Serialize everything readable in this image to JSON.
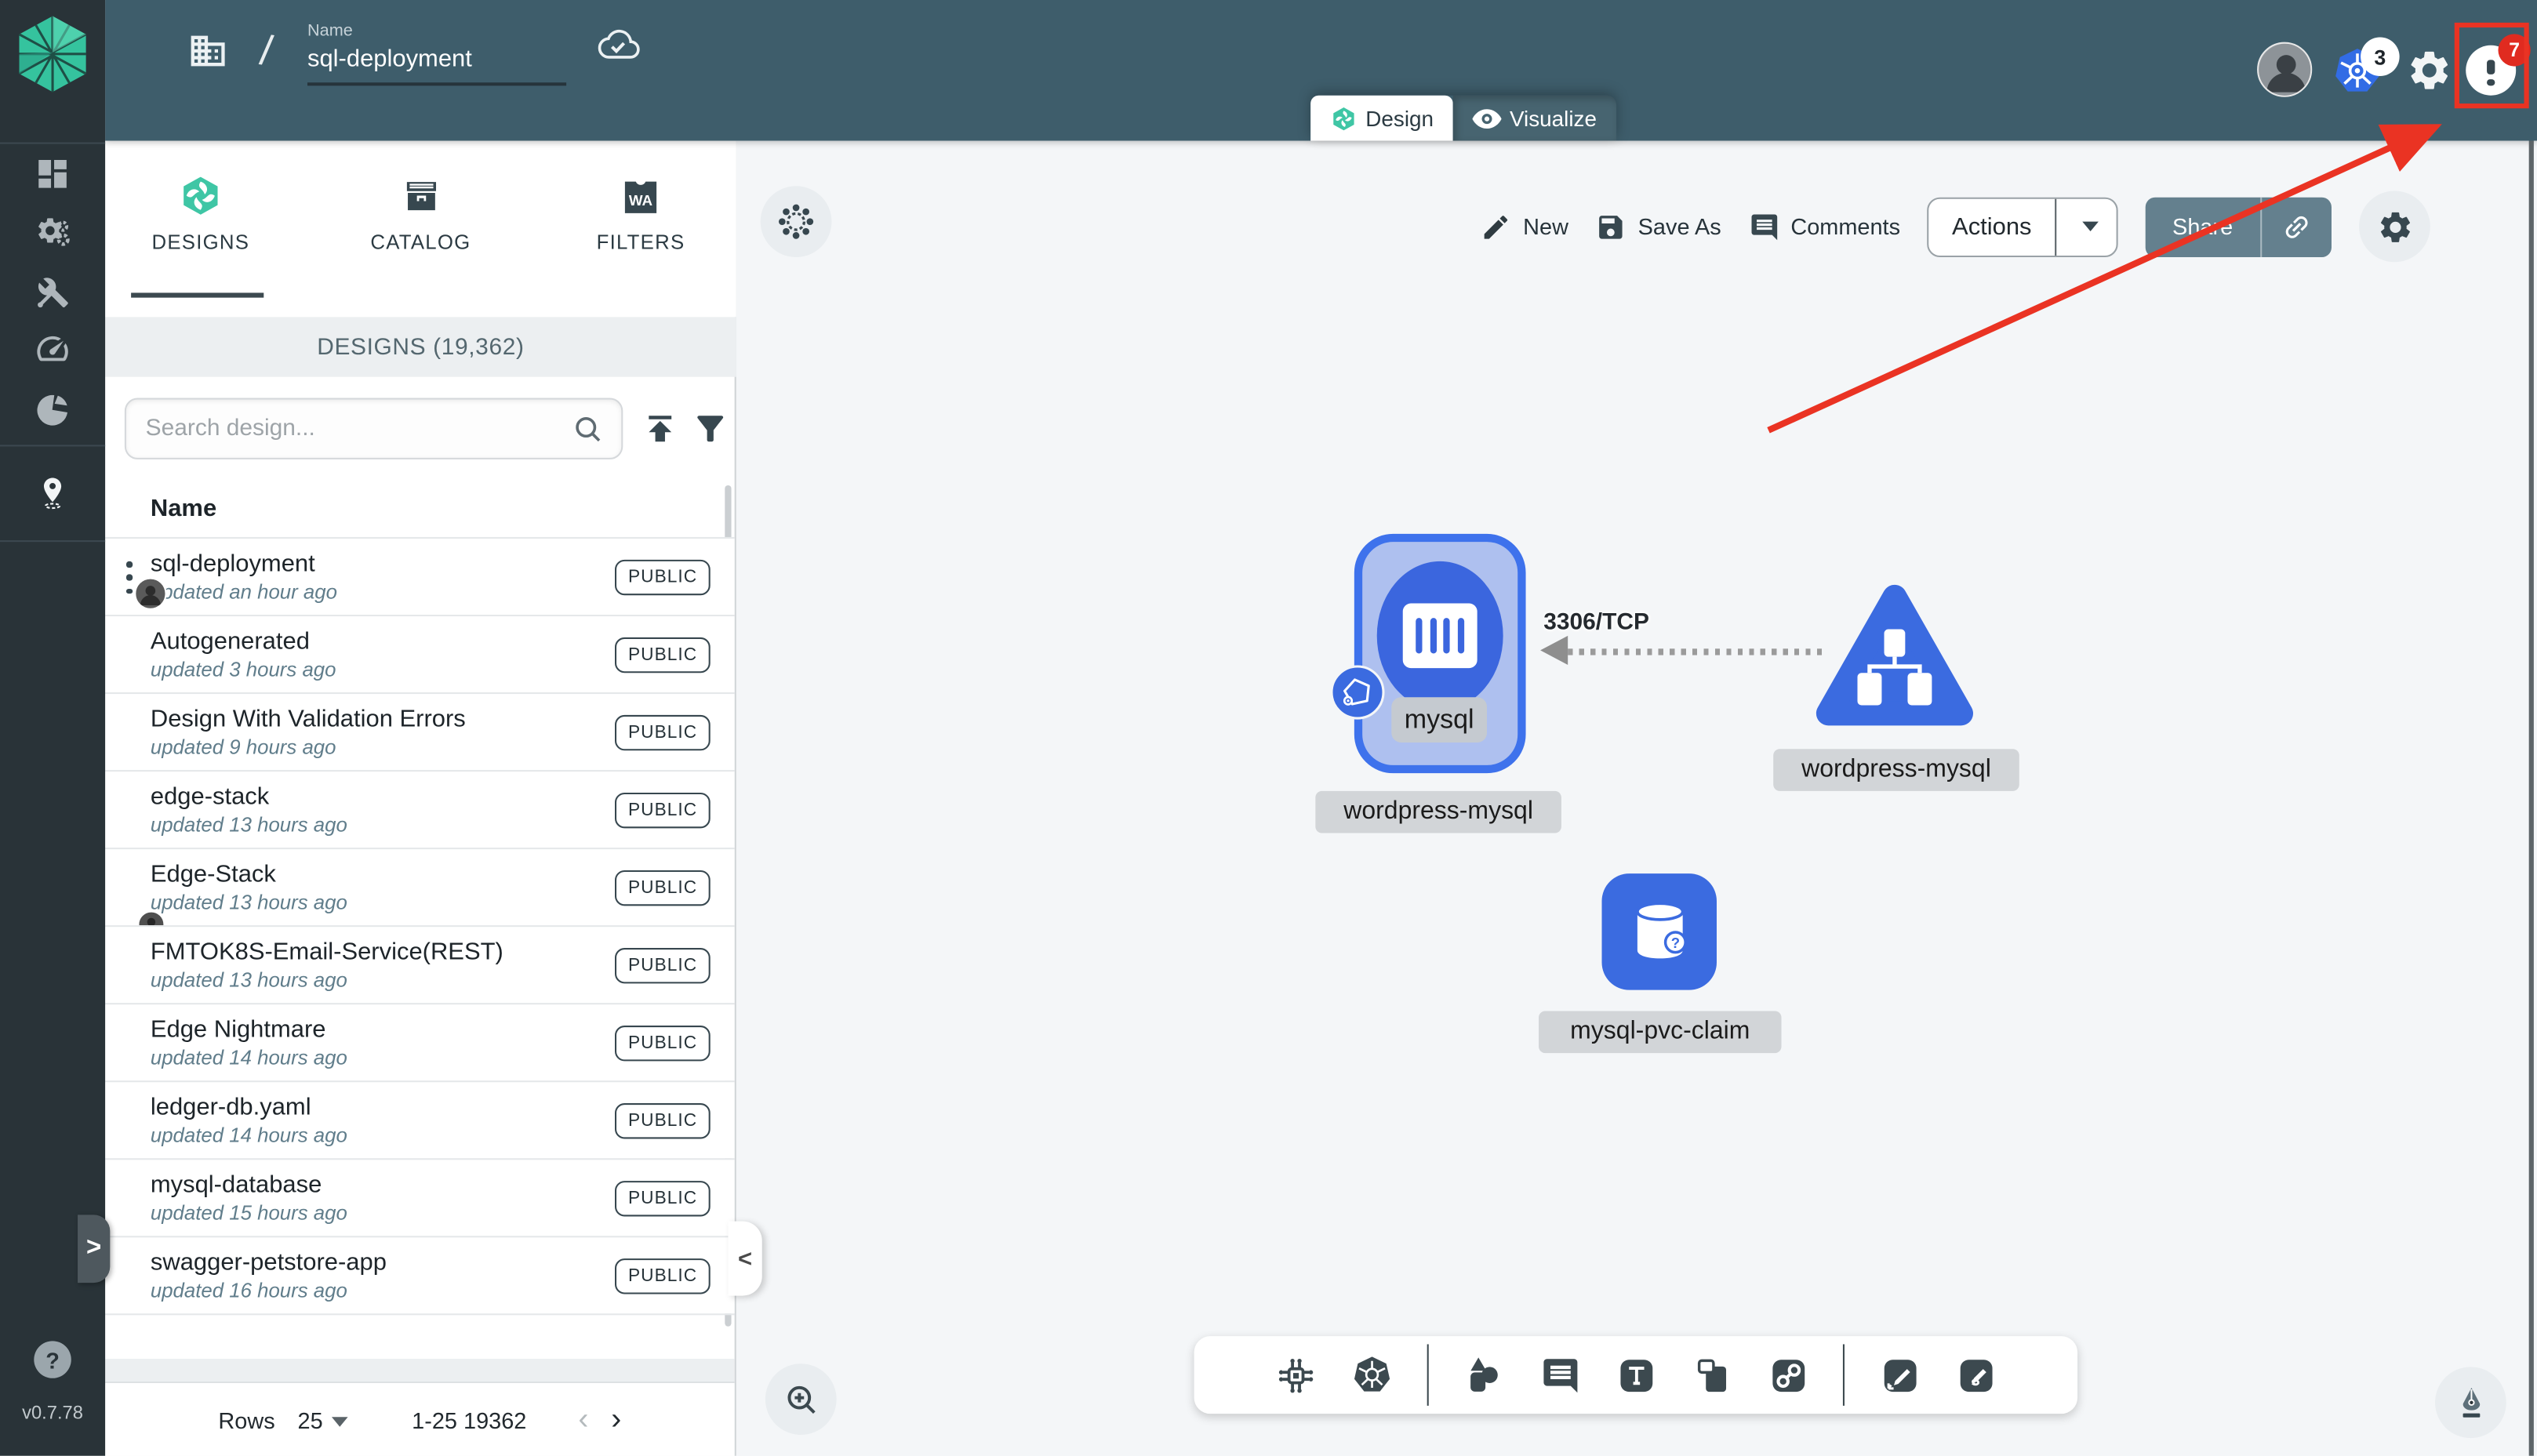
{
  "topbar": {
    "name_label": "Name",
    "name_value": "sql-deployment",
    "slash": "/",
    "mode_tabs": {
      "design": "Design",
      "visualize": "Visualize"
    },
    "k8s_context_count": "3",
    "notification_count": "7"
  },
  "sidebar": {
    "version": "v0.7.78",
    "help": "?",
    "expander": ">"
  },
  "panel": {
    "tabs": {
      "designs": "DESIGNS",
      "catalog": "CATALOG",
      "filters": "FILTERS"
    },
    "filters_icon_text": "WA",
    "section_title": "DESIGNS (19,362)",
    "search_placeholder": "Search design...",
    "name_header": "Name",
    "rows": [
      {
        "name": "sql-deployment",
        "updated": "updated an hour ago",
        "visibility": "PUBLIC"
      },
      {
        "name": "Autogenerated",
        "updated": "updated 3 hours ago",
        "visibility": "PUBLIC"
      },
      {
        "name": "Design With Validation Errors",
        "updated": "updated 9 hours ago",
        "visibility": "PUBLIC"
      },
      {
        "name": "edge-stack",
        "updated": "updated 13 hours ago",
        "visibility": "PUBLIC"
      },
      {
        "name": "Edge-Stack",
        "updated": "updated 13 hours ago",
        "visibility": "PUBLIC"
      },
      {
        "name": "FMTOK8S-Email-Service(REST)",
        "updated": "updated 13 hours ago",
        "visibility": "PUBLIC"
      },
      {
        "name": "Edge Nightmare",
        "updated": "updated 14 hours ago",
        "visibility": "PUBLIC"
      },
      {
        "name": "ledger-db.yaml",
        "updated": "updated 14 hours ago",
        "visibility": "PUBLIC"
      },
      {
        "name": "mysql-database",
        "updated": "updated 15 hours ago",
        "visibility": "PUBLIC"
      },
      {
        "name": "swagger-petstore-app",
        "updated": "updated 16 hours ago",
        "visibility": "PUBLIC"
      }
    ],
    "footer": {
      "rows_label": "Rows",
      "rows_per_page": "25",
      "range": "1-25 19362",
      "prev": "‹",
      "next": "›"
    },
    "collapse_chevron": "<"
  },
  "canvas": {
    "toolbar": {
      "new": "New",
      "save_as": "Save As",
      "comments": "Comments",
      "actions": "Actions",
      "share": "Share"
    },
    "diagram": {
      "deployment_node_label": "wordpress-mysql",
      "deployment_container_label": "mysql",
      "service_node_label": "wordpress-mysql",
      "pvc_node_label": "mysql-pvc-claim",
      "edge_label": "3306/TCP",
      "pvc_question": "?"
    }
  },
  "colors": {
    "topbar": "#3E5D6B",
    "sidebar": "#293338",
    "canvas": "#F4F6F8",
    "node_blue": "#3B6BE0",
    "node_border_blue": "#3E72EC",
    "node_fill_light": "#AEC0EF",
    "kubernetes_blue": "#326CE5",
    "annotation_red": "#EA3323",
    "badge_red": "#E02B20",
    "meshery_green": "#00B39F",
    "icon_slate": "#3C494F"
  }
}
